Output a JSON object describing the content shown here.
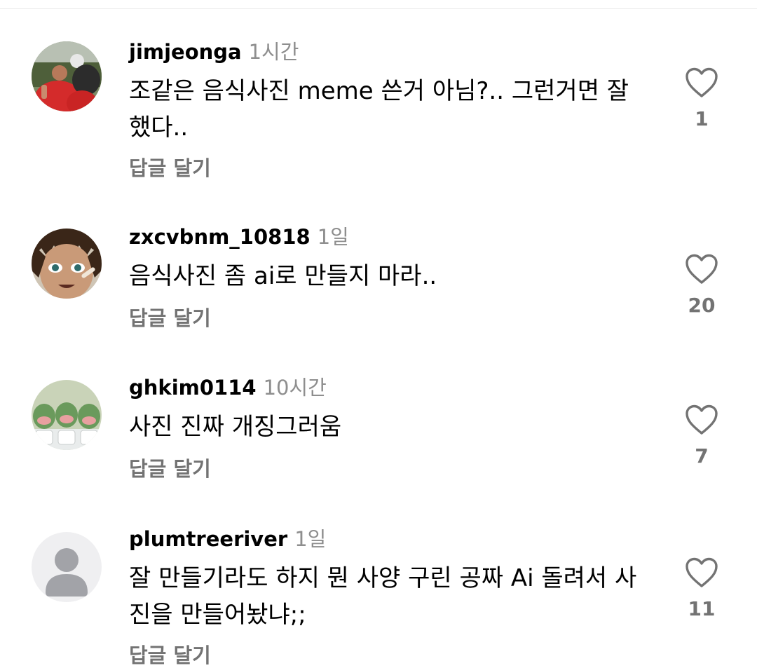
{
  "comments": [
    {
      "username": "jimjeonga",
      "time": "1시간",
      "text": "조같은 음식사진 meme 쓴거 아님?.. 그런거면 잘했다..",
      "reply_label": "답글 달기",
      "likes": "1",
      "avatar_icon": "photo-avatar-icon"
    },
    {
      "username": "zxcvbnm_10818",
      "time": "1일",
      "text": "음식사진 좀 ai로 만들지 마라..",
      "reply_label": "답글 달기",
      "likes": "20",
      "avatar_icon": "anime-avatar-icon"
    },
    {
      "username": "ghkim0114",
      "time": "10시간",
      "text": "사진 진짜 개징그러움",
      "reply_label": "답글 달기",
      "likes": "7",
      "avatar_icon": "frog-avatar-icon"
    },
    {
      "username": "plumtreeriver",
      "time": "1일",
      "text": "잘 만들기라도 하지 뭔 사양 구린 공짜 Ai 돌려서 사진을 만들어놨냐;;",
      "reply_label": "답글 달기",
      "likes": "11",
      "avatar_icon": "default-user-icon"
    }
  ],
  "colors": {
    "username": "#000000",
    "time": "#8e8e8e",
    "secondary": "#737373",
    "heart_outline": "#737373",
    "default_avatar_bg": "#efeff1",
    "default_avatar_fg": "#a2a3a8"
  }
}
